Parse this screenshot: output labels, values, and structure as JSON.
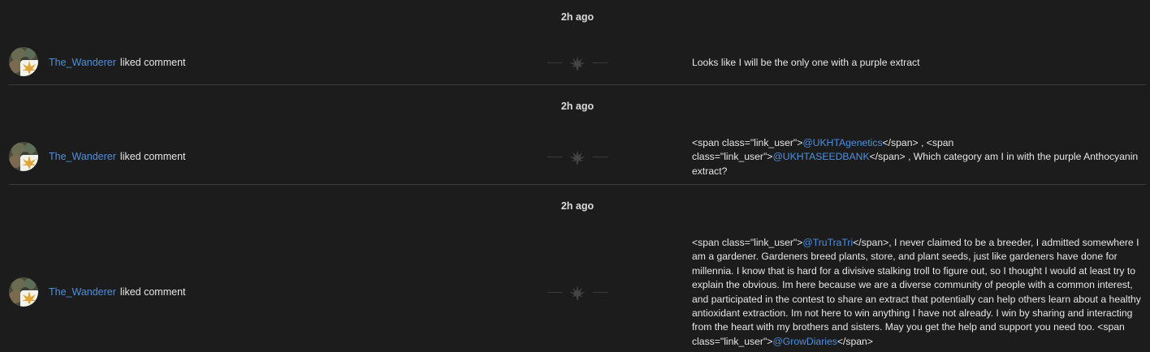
{
  "activity": [
    {
      "time": "2h ago",
      "user": "The_Wanderer",
      "action": "liked comment",
      "comment": [
        {
          "t": "Looks like I will be the only one with a purple extract"
        }
      ]
    },
    {
      "time": "2h ago",
      "user": "The_Wanderer",
      "action": "liked comment",
      "comment": [
        {
          "t": "<span class=\"link_user\">"
        },
        {
          "u": "@UKHTAgenetics"
        },
        {
          "t": "</span> , <span class=\"link_user\">"
        },
        {
          "u": "@UKHTASEEDBANK"
        },
        {
          "t": "</span> , Which category am I in with the purple Anthocyanin extract?"
        }
      ]
    },
    {
      "time": "2h ago",
      "user": "The_Wanderer",
      "action": "liked comment",
      "comment": [
        {
          "t": "<span class=\"link_user\">"
        },
        {
          "u": "@TruTraTri"
        },
        {
          "t": "</span>, I never claimed to be a breeder, I admitted somewhere I am a gardener. Gardeners breed plants, store, and plant seeds, just like gardeners have done for millennia. I know that is hard for a divisive stalking troll to figure out, so I thought I would at least try to explain the obvious. Im here because we are a diverse community of people with a common interest, and participated in the contest to share an extract that potentially can help others learn about a healthy antioxidant extraction. Im not here to win anything I have not already. I win by sharing and interacting from the heart with my brothers and sisters. May you get the help and support you need too. <span class=\"link_user\">"
        },
        {
          "u": "@GrowDiaries"
        },
        {
          "t": "</span>"
        }
      ]
    }
  ],
  "colors": {
    "background": "#1c1c1c",
    "link": "#4d8fe0",
    "text": "#e6e6e6",
    "divider": "#3a3a3a"
  },
  "icons": {
    "avatar": "user-avatar",
    "separator": "cannabis-leaf-icon"
  }
}
